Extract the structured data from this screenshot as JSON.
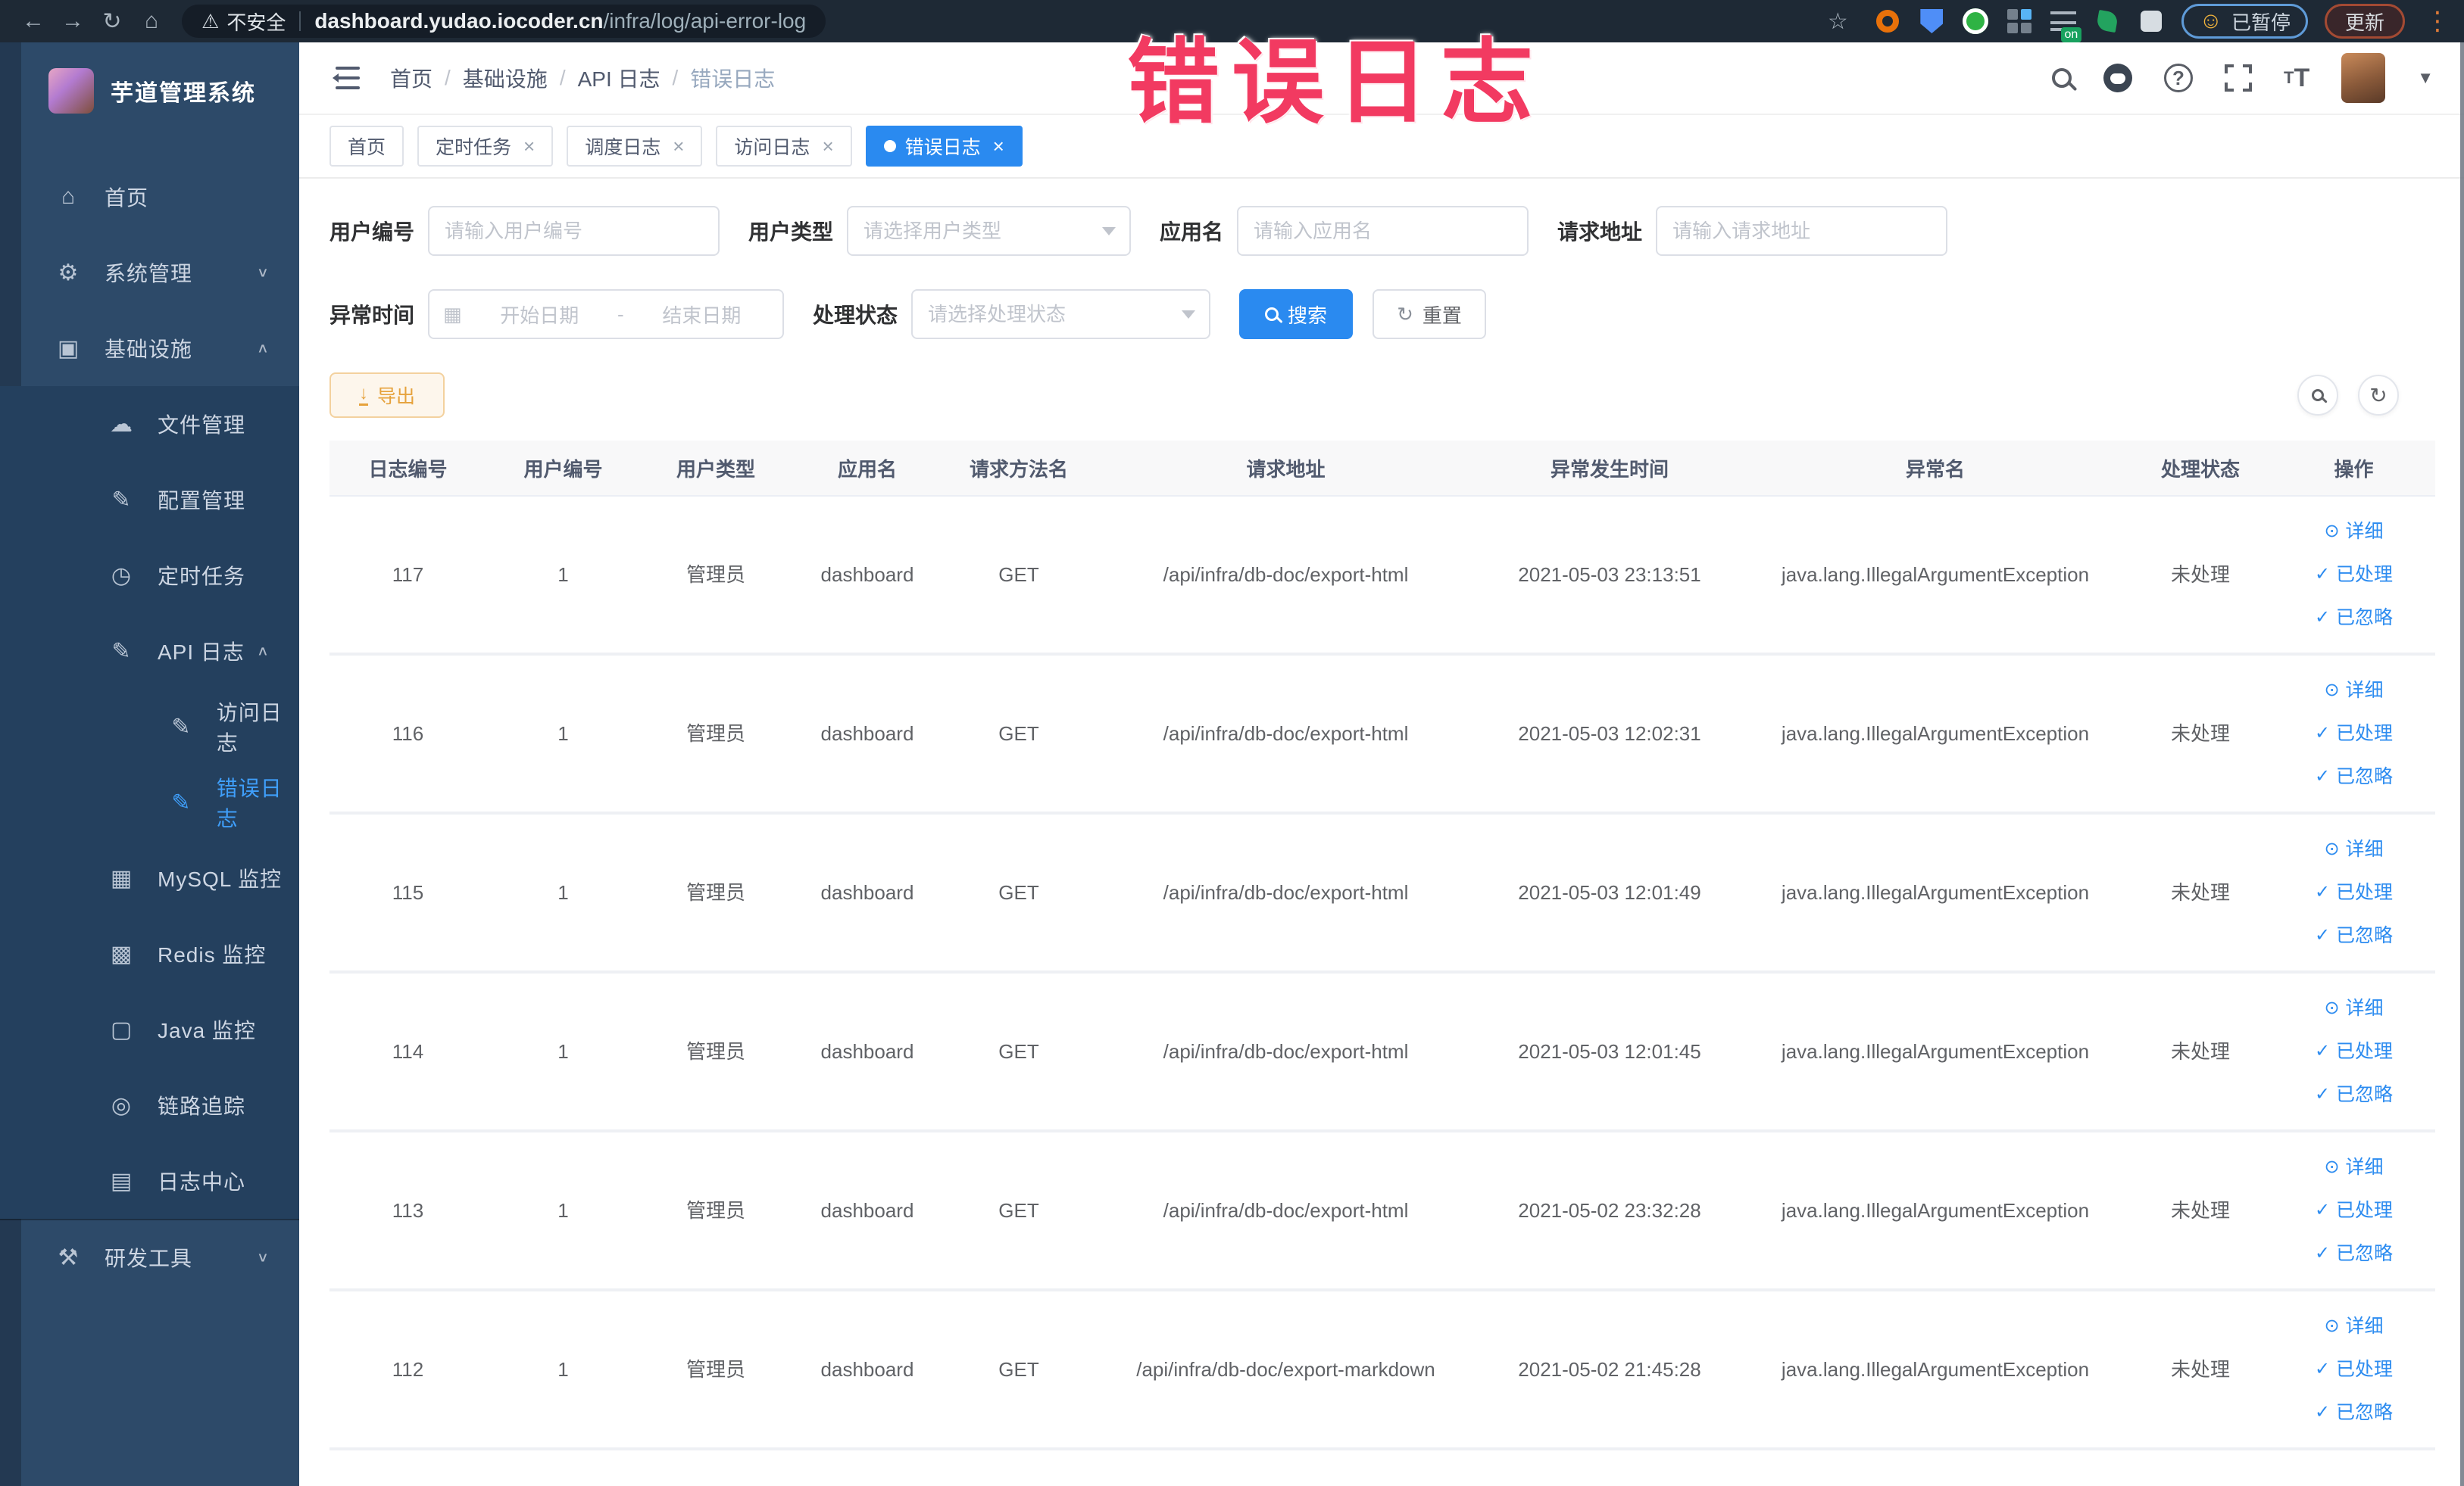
{
  "colors": {
    "accent-blue": "#2a8af0",
    "link-blue": "#2d8cf0",
    "warning-orange": "#e6a23c",
    "sidebar-bg": "#2d4a69",
    "sidebar-sub-bg": "#24405e",
    "browser-bar-bg": "#1e2935",
    "overlay-pink": "#f23a61"
  },
  "browser": {
    "security_label": "不安全",
    "url_domain": "dashboard.yudao.iocoder.cn",
    "url_path": "/infra/log/api-error-log",
    "paused_badge": "已暂停",
    "update_button": "更新"
  },
  "overlay": {
    "title": "错误日志"
  },
  "sidebar": {
    "logo_title": "芋道管理系统",
    "items": [
      {
        "key": "home",
        "label": "首页",
        "icon": "home",
        "level": 1,
        "chevron": "",
        "active": false
      },
      {
        "key": "system",
        "label": "系统管理",
        "icon": "gear",
        "level": 1,
        "chevron": "down",
        "active": false
      },
      {
        "key": "infra",
        "label": "基础设施",
        "icon": "monitor",
        "level": 1,
        "chevron": "up",
        "active": false
      },
      {
        "key": "file",
        "label": "文件管理",
        "icon": "cloud-upload",
        "level": 2,
        "chevron": "",
        "active": false
      },
      {
        "key": "config",
        "label": "配置管理",
        "icon": "edit",
        "level": 2,
        "chevron": "",
        "active": false
      },
      {
        "key": "job",
        "label": "定时任务",
        "icon": "timer",
        "level": 2,
        "chevron": "",
        "active": false
      },
      {
        "key": "api-log",
        "label": "API 日志",
        "icon": "edit",
        "level": 2,
        "chevron": "up",
        "active": false
      },
      {
        "key": "access-log",
        "label": "访问日志",
        "icon": "edit",
        "level": 3,
        "chevron": "",
        "active": false
      },
      {
        "key": "error-log",
        "label": "错误日志",
        "icon": "edit",
        "level": 3,
        "chevron": "",
        "active": true
      },
      {
        "key": "mysql",
        "label": "MySQL 监控",
        "icon": "database",
        "level": 2,
        "chevron": "",
        "active": false
      },
      {
        "key": "redis",
        "label": "Redis 监控",
        "icon": "layers",
        "level": 2,
        "chevron": "",
        "active": false
      },
      {
        "key": "java",
        "label": "Java 监控",
        "icon": "screen",
        "level": 2,
        "chevron": "",
        "active": false
      },
      {
        "key": "trace",
        "label": "链路追踪",
        "icon": "eye",
        "level": 2,
        "chevron": "",
        "active": false
      },
      {
        "key": "log-center",
        "label": "日志中心",
        "icon": "document",
        "level": 2,
        "chevron": "",
        "active": false
      },
      {
        "key": "dev-tools",
        "label": "研发工具",
        "icon": "tools",
        "level": 1,
        "chevron": "down",
        "active": false,
        "divider": true
      }
    ]
  },
  "header": {
    "breadcrumb": [
      "首页",
      "基础设施",
      "API 日志",
      "错误日志"
    ]
  },
  "tabs": [
    {
      "label": "首页",
      "closable": false,
      "active": false
    },
    {
      "label": "定时任务",
      "closable": true,
      "active": false
    },
    {
      "label": "调度日志",
      "closable": true,
      "active": false
    },
    {
      "label": "访问日志",
      "closable": true,
      "active": false
    },
    {
      "label": "错误日志",
      "closable": true,
      "active": true
    }
  ],
  "filters": {
    "user_id": {
      "label": "用户编号",
      "placeholder": "请输入用户编号"
    },
    "user_type": {
      "label": "用户类型",
      "placeholder": "请选择用户类型"
    },
    "app_name": {
      "label": "应用名",
      "placeholder": "请输入应用名"
    },
    "request_url": {
      "label": "请求地址",
      "placeholder": "请输入请求地址"
    },
    "exception_time": {
      "label": "异常时间",
      "start_placeholder": "开始日期",
      "separator": "-",
      "end_placeholder": "结束日期"
    },
    "process_status": {
      "label": "处理状态",
      "placeholder": "请选择处理状态"
    },
    "search_button": "搜索",
    "reset_button": "重置"
  },
  "toolbar": {
    "export_button": "导出"
  },
  "table": {
    "columns": [
      "日志编号",
      "用户编号",
      "用户类型",
      "应用名",
      "请求方法名",
      "请求地址",
      "异常发生时间",
      "异常名",
      "处理状态",
      "操作"
    ],
    "actions": {
      "detail": "详细",
      "processed": "已处理",
      "ignored": "已忽略"
    },
    "rows": [
      {
        "id": "117",
        "user_id": "1",
        "user_type": "管理员",
        "app": "dashboard",
        "method": "GET",
        "url": "/api/infra/db-doc/export-html",
        "time": "2021-05-03 23:13:51",
        "exception": "java.lang.IllegalArgumentException",
        "status": "未处理"
      },
      {
        "id": "116",
        "user_id": "1",
        "user_type": "管理员",
        "app": "dashboard",
        "method": "GET",
        "url": "/api/infra/db-doc/export-html",
        "time": "2021-05-03 12:02:31",
        "exception": "java.lang.IllegalArgumentException",
        "status": "未处理"
      },
      {
        "id": "115",
        "user_id": "1",
        "user_type": "管理员",
        "app": "dashboard",
        "method": "GET",
        "url": "/api/infra/db-doc/export-html",
        "time": "2021-05-03 12:01:49",
        "exception": "java.lang.IllegalArgumentException",
        "status": "未处理"
      },
      {
        "id": "114",
        "user_id": "1",
        "user_type": "管理员",
        "app": "dashboard",
        "method": "GET",
        "url": "/api/infra/db-doc/export-html",
        "time": "2021-05-03 12:01:45",
        "exception": "java.lang.IllegalArgumentException",
        "status": "未处理"
      },
      {
        "id": "113",
        "user_id": "1",
        "user_type": "管理员",
        "app": "dashboard",
        "method": "GET",
        "url": "/api/infra/db-doc/export-html",
        "time": "2021-05-02 23:32:28",
        "exception": "java.lang.IllegalArgumentException",
        "status": "未处理"
      },
      {
        "id": "112",
        "user_id": "1",
        "user_type": "管理员",
        "app": "dashboard",
        "method": "GET",
        "url": "/api/infra/db-doc/export-markdown",
        "time": "2021-05-02 21:45:28",
        "exception": "java.lang.IllegalArgumentException",
        "status": "未处理"
      }
    ]
  }
}
